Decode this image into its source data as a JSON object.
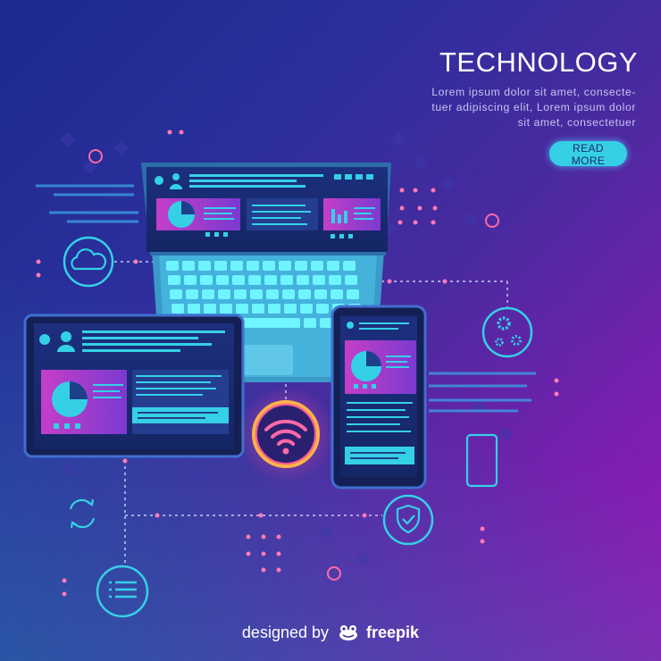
{
  "heading": "TECHNOLOGY",
  "description": [
    "Lorem ipsum dolor sit amet, consecte-",
    "tuer adipiscing elit, Lorem ipsum dolor",
    "sit amet, consectetuer"
  ],
  "cta": {
    "label": "READ MORE"
  },
  "credit": {
    "prefix": "designed by",
    "brand": "freepik"
  },
  "colors": {
    "cyan": "#35d0e6",
    "magenta": "#c43ec8",
    "pink_glow": "#ff5a9a",
    "bg_top": "#9a1ab8",
    "bg_bottom": "#1c2a8e"
  },
  "icons": [
    "cloud-icon",
    "gears-icon",
    "shield-check-icon",
    "list-icon",
    "sync-icon",
    "phone-outline-icon",
    "wifi-icon",
    "user-icon",
    "pie-chart-icon",
    "bar-chart-icon"
  ]
}
